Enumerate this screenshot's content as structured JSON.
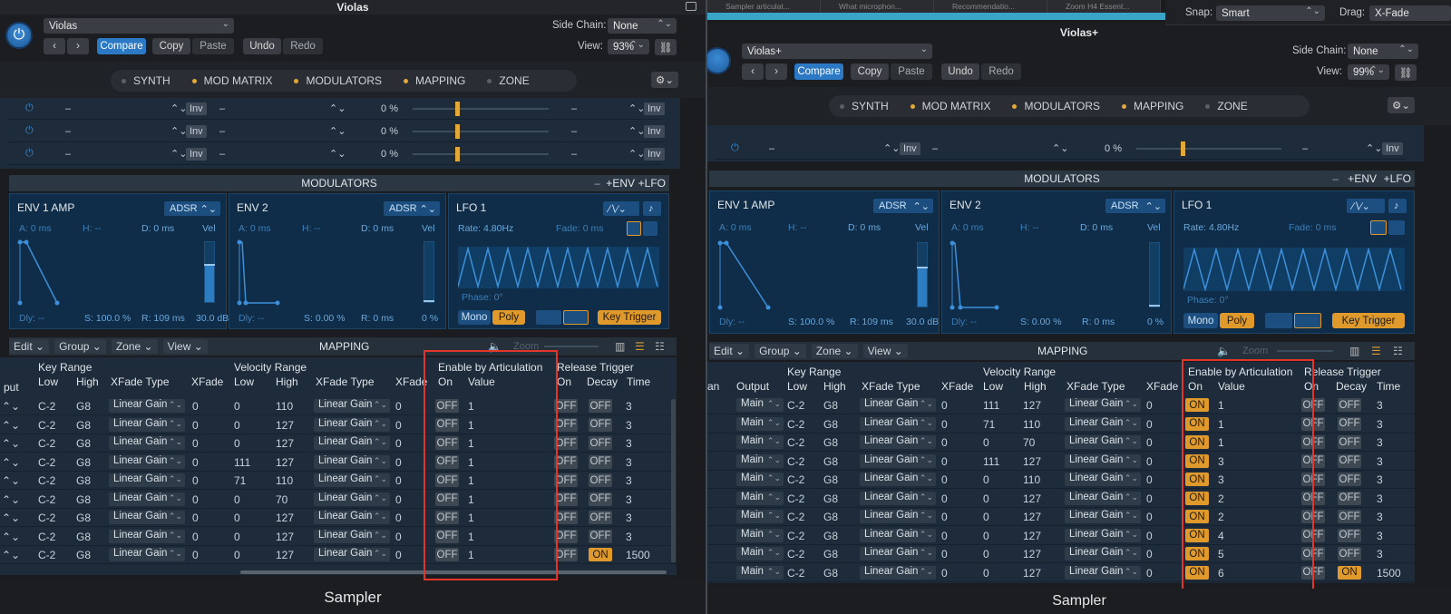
{
  "left": {
    "title": "Violas",
    "preset": "Violas",
    "side_chain_label": "Side Chain:",
    "side_chain_value": "None",
    "view_label": "View:",
    "view_value": "93%",
    "compare": "Compare",
    "copy": "Copy",
    "paste": "Paste",
    "undo": "Undo",
    "redo": "Redo",
    "xfade_types_header": "XFade Type",
    "rows": [
      {
        "low": "C-2",
        "high": "G8",
        "xt": "Linear Gain",
        "xf": "0",
        "vl": "0",
        "vh": "110",
        "vxt": "Linear Gain",
        "vxf": "0",
        "on": "OFF",
        "val": "1",
        "rt": "OFF",
        "dc": "OFF",
        "tm": "3"
      },
      {
        "low": "C-2",
        "high": "G8",
        "xt": "Linear Gain",
        "xf": "0",
        "vl": "0",
        "vh": "127",
        "vxt": "Linear Gain",
        "vxf": "0",
        "on": "OFF",
        "val": "1",
        "rt": "OFF",
        "dc": "OFF",
        "tm": "3"
      },
      {
        "low": "C-2",
        "high": "G8",
        "xt": "Linear Gain",
        "xf": "0",
        "vl": "0",
        "vh": "127",
        "vxt": "Linear Gain",
        "vxf": "0",
        "on": "OFF",
        "val": "1",
        "rt": "OFF",
        "dc": "OFF",
        "tm": "3"
      },
      {
        "low": "C-2",
        "high": "G8",
        "xt": "Linear Gain",
        "xf": "0",
        "vl": "111",
        "vh": "127",
        "vxt": "Linear Gain",
        "vxf": "0",
        "on": "OFF",
        "val": "1",
        "rt": "OFF",
        "dc": "OFF",
        "tm": "3"
      },
      {
        "low": "C-2",
        "high": "G8",
        "xt": "Linear Gain",
        "xf": "0",
        "vl": "71",
        "vh": "110",
        "vxt": "Linear Gain",
        "vxf": "0",
        "on": "OFF",
        "val": "1",
        "rt": "OFF",
        "dc": "OFF",
        "tm": "3"
      },
      {
        "low": "C-2",
        "high": "G8",
        "xt": "Linear Gain",
        "xf": "0",
        "vl": "0",
        "vh": "70",
        "vxt": "Linear Gain",
        "vxf": "0",
        "on": "OFF",
        "val": "1",
        "rt": "OFF",
        "dc": "OFF",
        "tm": "3"
      },
      {
        "low": "C-2",
        "high": "G8",
        "xt": "Linear Gain",
        "xf": "0",
        "vl": "0",
        "vh": "127",
        "vxt": "Linear Gain",
        "vxf": "0",
        "on": "OFF",
        "val": "1",
        "rt": "OFF",
        "dc": "OFF",
        "tm": "3"
      },
      {
        "low": "C-2",
        "high": "G8",
        "xt": "Linear Gain",
        "xf": "0",
        "vl": "0",
        "vh": "127",
        "vxt": "Linear Gain",
        "vxf": "0",
        "on": "OFF",
        "val": "1",
        "rt": "OFF",
        "dc": "OFF",
        "tm": "3"
      },
      {
        "low": "C-2",
        "high": "G8",
        "xt": "Linear Gain",
        "xf": "0",
        "vl": "0",
        "vh": "127",
        "vxt": "Linear Gain",
        "vxf": "0",
        "on": "OFF",
        "val": "1",
        "rt": "OFF",
        "dc": "ON",
        "tm": "1500"
      }
    ]
  },
  "right": {
    "title": "Violas+",
    "preset": "Violas+",
    "side_chain_label": "Side Chain:",
    "side_chain_value": "None",
    "view_label": "View:",
    "view_value": "99%",
    "compare": "Compare",
    "copy": "Copy",
    "paste": "Paste",
    "undo": "Undo",
    "redo": "Redo",
    "snap_label": "Snap:",
    "snap_value": "Smart",
    "drag_label": "Drag:",
    "drag_value": "X-Fade",
    "browser_tabs": [
      "Sampler articulat...",
      "What microphon...",
      "Recommendatio...",
      "Zoom H4 Essent..."
    ],
    "output_header": "Output",
    "rows": [
      {
        "out": "Main",
        "low": "C-2",
        "high": "G8",
        "xt": "Linear Gain",
        "xf": "0",
        "vl": "111",
        "vh": "127",
        "vxt": "Linear Gain",
        "vxf": "0",
        "on": "ON",
        "val": "1",
        "rt": "OFF",
        "dc": "OFF",
        "tm": "3"
      },
      {
        "out": "Main",
        "low": "C-2",
        "high": "G8",
        "xt": "Linear Gain",
        "xf": "0",
        "vl": "71",
        "vh": "110",
        "vxt": "Linear Gain",
        "vxf": "0",
        "on": "ON",
        "val": "1",
        "rt": "OFF",
        "dc": "OFF",
        "tm": "3"
      },
      {
        "out": "Main",
        "low": "C-2",
        "high": "G8",
        "xt": "Linear Gain",
        "xf": "0",
        "vl": "0",
        "vh": "70",
        "vxt": "Linear Gain",
        "vxf": "0",
        "on": "ON",
        "val": "1",
        "rt": "OFF",
        "dc": "OFF",
        "tm": "3"
      },
      {
        "out": "Main",
        "low": "C-2",
        "high": "G8",
        "xt": "Linear Gain",
        "xf": "0",
        "vl": "111",
        "vh": "127",
        "vxt": "Linear Gain",
        "vxf": "0",
        "on": "ON",
        "val": "3",
        "rt": "OFF",
        "dc": "OFF",
        "tm": "3"
      },
      {
        "out": "Main",
        "low": "C-2",
        "high": "G8",
        "xt": "Linear Gain",
        "xf": "0",
        "vl": "0",
        "vh": "110",
        "vxt": "Linear Gain",
        "vxf": "0",
        "on": "ON",
        "val": "3",
        "rt": "OFF",
        "dc": "OFF",
        "tm": "3"
      },
      {
        "out": "Main",
        "low": "C-2",
        "high": "G8",
        "xt": "Linear Gain",
        "xf": "0",
        "vl": "0",
        "vh": "127",
        "vxt": "Linear Gain",
        "vxf": "0",
        "on": "ON",
        "val": "2",
        "rt": "OFF",
        "dc": "OFF",
        "tm": "3"
      },
      {
        "out": "Main",
        "low": "C-2",
        "high": "G8",
        "xt": "Linear Gain",
        "xf": "0",
        "vl": "0",
        "vh": "127",
        "vxt": "Linear Gain",
        "vxf": "0",
        "on": "ON",
        "val": "2",
        "rt": "OFF",
        "dc": "OFF",
        "tm": "3"
      },
      {
        "out": "Main",
        "low": "C-2",
        "high": "G8",
        "xt": "Linear Gain",
        "xf": "0",
        "vl": "0",
        "vh": "127",
        "vxt": "Linear Gain",
        "vxf": "0",
        "on": "ON",
        "val": "4",
        "rt": "OFF",
        "dc": "OFF",
        "tm": "3"
      },
      {
        "out": "Main",
        "low": "C-2",
        "high": "G8",
        "xt": "Linear Gain",
        "xf": "0",
        "vl": "0",
        "vh": "127",
        "vxt": "Linear Gain",
        "vxf": "0",
        "on": "ON",
        "val": "5",
        "rt": "OFF",
        "dc": "OFF",
        "tm": "3"
      },
      {
        "out": "Main",
        "low": "C-2",
        "high": "G8",
        "xt": "Linear Gain",
        "xf": "0",
        "vl": "0",
        "vh": "127",
        "vxt": "Linear Gain",
        "vxf": "0",
        "on": "ON",
        "val": "6",
        "rt": "OFF",
        "dc": "ON",
        "tm": "1500"
      }
    ]
  },
  "shared": {
    "tabs": [
      "SYNTH",
      "MOD MATRIX",
      "MODULATORS",
      "MAPPING",
      "ZONE"
    ],
    "tab_dots": [
      false,
      true,
      true,
      true,
      false
    ],
    "inv": "Inv",
    "dash": "–",
    "zero_pct": "0",
    "pct": "%",
    "modulators_title": "MODULATORS",
    "env_btn": "ENV",
    "lfo_btn": "LFO",
    "env1": {
      "name": "ENV 1 AMP",
      "mode": "ADSR",
      "a": "A: 0",
      "h": "H: --",
      "d": "D: 0",
      "vel": "Vel",
      "dly": "Dly: --",
      "s": "S: 100.0",
      "r": "R: 109",
      "db": "30.0",
      "ms": "ms",
      "pct": "%",
      "dbu": "dB",
      "vel_level": 0.62
    },
    "env2": {
      "name": "ENV 2",
      "mode": "ADSR",
      "a": "A: 0",
      "h": "H: --",
      "d": "D: 0",
      "vel": "Vel",
      "dly": "Dly: --",
      "s": "S: 0.00",
      "r": "R: 0",
      "z": "0",
      "ms": "ms",
      "pct": "%",
      "vel_level": 0.0
    },
    "lfo": {
      "name": "LFO 1",
      "rate": "Rate: 4.80Hz",
      "fade": "Fade: 0",
      "ms": "ms",
      "phase": "Phase: 0°",
      "mono": "Mono",
      "poly": "Poly",
      "key_trigger": "Key Trigger"
    },
    "mapping": {
      "edit": "Edit",
      "group": "Group",
      "zone": "Zone",
      "view": "View",
      "title": "MAPPING",
      "zoom": "Zoom"
    },
    "headers": {
      "key_range": "Key Range",
      "low": "Low",
      "high": "High",
      "xfade_type": "XFade Type",
      "xfade": "XFade",
      "velocity_range": "Velocity Range",
      "enable_art": "Enable by Articulation",
      "on": "On",
      "value": "Value",
      "release": "Release Trigger",
      "decay": "Decay",
      "time": "Time",
      "put": "put",
      "an": "an"
    },
    "footer": "Sampler",
    "colors": {
      "accent_blue": "#2b78c4",
      "on_orange": "#e09a2c",
      "highlight_red": "#e5352b",
      "panel": "#1d2b3a"
    }
  }
}
